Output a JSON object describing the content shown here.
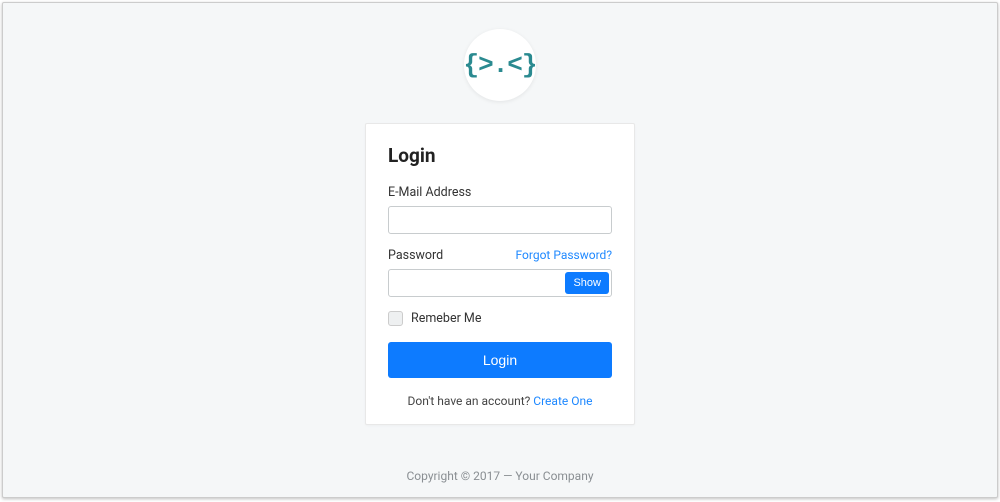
{
  "logo": {
    "text": "{>.<}"
  },
  "card": {
    "title": "Login",
    "email": {
      "label": "E-Mail Address",
      "value": ""
    },
    "password": {
      "label": "Password",
      "forgot": "Forgot Password?",
      "value": "",
      "show_btn": "Show"
    },
    "remember": {
      "label": "Remeber Me",
      "checked": false
    },
    "submit": "Login",
    "signup": {
      "prompt": "Don't have an account? ",
      "link": "Create One"
    }
  },
  "footer": "Copyright © 2017 — Your Company"
}
